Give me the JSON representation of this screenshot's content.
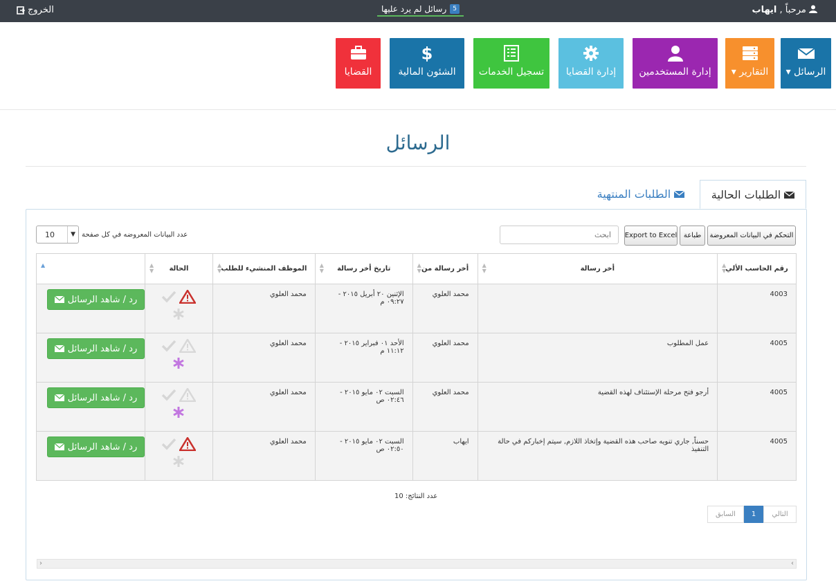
{
  "topbar": {
    "welcome_prefix": "مرحباً ,",
    "username": "ايهاب",
    "unread_label": "رسائل لم يرد عليها",
    "unread_count": "5",
    "logout_label": "الخروج"
  },
  "tiles": [
    {
      "label": "الرسائل",
      "icon": "envelope-icon",
      "color": "#1a74a8",
      "caret": true
    },
    {
      "label": "التقارير",
      "icon": "server-icon",
      "color": "#f7902d",
      "caret": true
    },
    {
      "label": "إدارة المستخدمين",
      "icon": "user-icon",
      "color": "#9b27b0",
      "caret": false
    },
    {
      "label": "إدارة القضايا",
      "icon": "gear-icon",
      "color": "#5bc0e0",
      "caret": false
    },
    {
      "label": "تسجيل الخدمات",
      "icon": "list-icon",
      "color": "#3fc53f",
      "caret": false
    },
    {
      "label": "الشئون المالية",
      "icon": "dollar-icon",
      "color": "#1a74a8",
      "caret": false
    },
    {
      "label": "القضايا",
      "icon": "briefcase-icon",
      "color": "#f0313b",
      "caret": false
    }
  ],
  "page_title": "الرسائل",
  "tabs": {
    "current": "الطلبات الحالية",
    "finished": "الطلبات المنتهية"
  },
  "controls": {
    "columns_button": "التحكم في البيانات المعروضة",
    "print_button": "طباعة",
    "excel_button": "Export to Excel",
    "search_placeholder": "ابحث",
    "per_page_label": "عدد البيانات المعروضه في كل صفحة",
    "per_page_value": "10"
  },
  "table": {
    "headers": {
      "computer_no": "رقم الحاسب الألي",
      "last_message": "أخر رسالة",
      "last_from": "أخر رسالة من",
      "last_date": "تاريخ أخر رسالة",
      "creator": "الموظف المنشيء للطلب",
      "status": "الحالة"
    },
    "reply_button": "رد / شاهد الرسائل",
    "rows": [
      {
        "computer_no": "4003",
        "last_message": "",
        "last_from": "محمد العلوي",
        "last_date": "الإثنين ٢٠ أبريل ٢٠١٥ - ٠٩:٢٧ م",
        "creator": "محمد العلوي"
      },
      {
        "computer_no": "4005",
        "last_message": "عمل المطلوب",
        "last_from": "محمد العلوي",
        "last_date": "الأحد ٠١ فبراير ٢٠١٥ - ١١:١٢ م",
        "creator": "محمد العلوي"
      },
      {
        "computer_no": "4005",
        "last_message": "أرجو فتح مرحلة الإستئناف لهذه القضية",
        "last_from": "محمد العلوي",
        "last_date": "السبت ٠٢ مايو ٢٠١٥ - ٠٢:٤٦ ص",
        "creator": "محمد العلوي"
      },
      {
        "computer_no": "4005",
        "last_message": "حسناً, جاري تنويه صاحب هذه القضية وإتخاذ اللازم, سيتم إخباركم في حالة التنفيذ",
        "last_from": "ايهاب",
        "last_date": "السبت ٠٢ مايو ٢٠١٥ - ٠٢:٥٠ ص",
        "creator": "محمد العلوي"
      }
    ]
  },
  "footer": {
    "results_label": "عدد النتائج: 10",
    "next": "التالي",
    "page": "1",
    "prev": "السابق"
  }
}
